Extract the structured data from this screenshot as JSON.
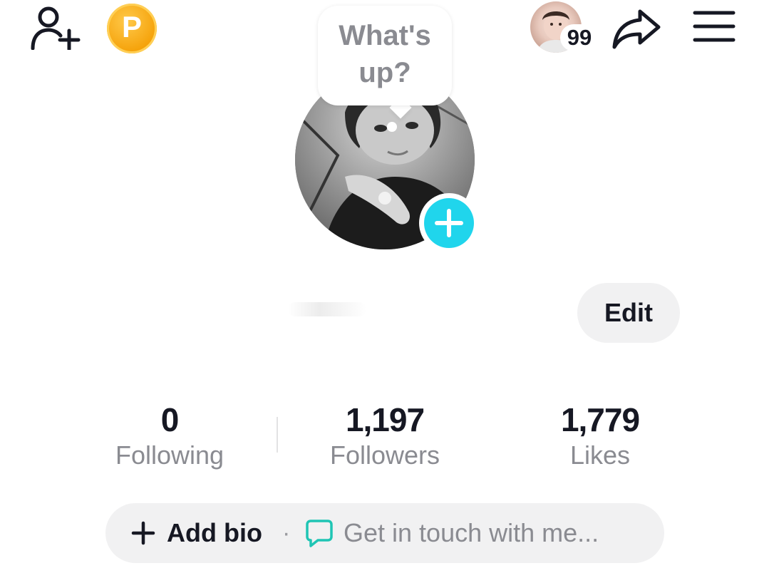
{
  "top_bar": {
    "coin_letter": "P",
    "story_badge": "99"
  },
  "bubble": {
    "text": "What's\nup?"
  },
  "profile": {
    "edit_label": "Edit"
  },
  "stats": [
    {
      "value": "0",
      "label": "Following"
    },
    {
      "value": "1,197",
      "label": "Followers"
    },
    {
      "value": "1,779",
      "label": "Likes"
    }
  ],
  "bio": {
    "add_label": "Add bio",
    "separator": "·",
    "contact_label": "Get in touch with me..."
  },
  "icons": {
    "add_friend": "person-plus-icon",
    "share": "share-arrow-icon",
    "menu": "hamburger-menu-icon",
    "add_photo": "plus-icon",
    "contact": "chat-bubble-icon"
  },
  "colors": {
    "accent_cyan": "#20d5ec",
    "coin_orange": "#f5a20a",
    "chat_teal": "#1fc5b4",
    "muted_text": "#8a8b91",
    "pill_bg": "#f1f1f2"
  }
}
